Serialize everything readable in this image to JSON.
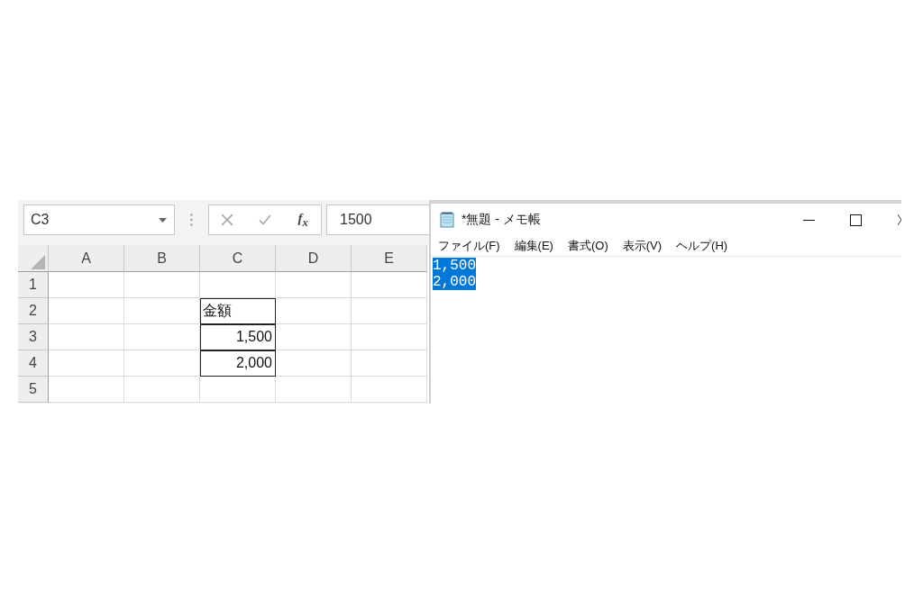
{
  "excel": {
    "name_box": {
      "value": "C3"
    },
    "formula_buttons": [
      {
        "kind": "cancel",
        "disabled": true
      },
      {
        "kind": "enter",
        "disabled": true
      },
      {
        "kind": "function",
        "label": "f$_{x}$"
      }
    ],
    "formula_bar": {
      "value": "1500"
    },
    "sheet": {
      "columns": [
        "A",
        "B",
        "C",
        "D",
        "E"
      ],
      "rows": [
        {
          "label": "1",
          "cells": [
            {
              "kind": "empty",
              "bordered": false
            },
            {
              "kind": "empty",
              "bordered": false
            },
            {
              "kind": "empty",
              "bordered": false
            },
            {
              "kind": "empty",
              "bordered": false
            },
            {
              "kind": "empty",
              "bordered": false
            }
          ]
        },
        {
          "label": "2",
          "cells": [
            {
              "kind": "empty",
              "bordered": false
            },
            {
              "kind": "empty",
              "bordered": false
            },
            {
              "kind": "text",
              "text": "金額",
              "bordered": true
            },
            {
              "kind": "empty",
              "bordered": false
            },
            {
              "kind": "empty",
              "bordered": false
            }
          ]
        },
        {
          "label": "3",
          "cells": [
            {
              "kind": "empty",
              "bordered": false
            },
            {
              "kind": "empty",
              "bordered": false
            },
            {
              "kind": "number",
              "text": "1,500",
              "bordered": true
            },
            {
              "kind": "empty",
              "bordered": false
            },
            {
              "kind": "empty",
              "bordered": false
            }
          ]
        },
        {
          "label": "4",
          "cells": [
            {
              "kind": "empty",
              "bordered": false
            },
            {
              "kind": "empty",
              "bordered": false
            },
            {
              "kind": "number",
              "text": "2,000",
              "bordered": true
            },
            {
              "kind": "empty",
              "bordered": false
            },
            {
              "kind": "empty",
              "bordered": false
            }
          ]
        },
        {
          "label": "5",
          "cells": [
            {
              "kind": "empty",
              "bordered": false
            },
            {
              "kind": "empty",
              "bordered": false
            },
            {
              "kind": "empty",
              "bordered": false
            },
            {
              "kind": "empty",
              "bordered": false
            },
            {
              "kind": "empty",
              "bordered": false
            }
          ]
        }
      ]
    }
  },
  "notepad": {
    "title": "*無題 - メモ帳",
    "menu": [
      "ファイル(F)",
      "編集(E)",
      "書式(O)",
      "表示(V)",
      "ヘルプ(H)"
    ],
    "lines": [
      {
        "text": "1,500",
        "selected": true
      },
      {
        "text": "2,000",
        "selected": true
      }
    ]
  }
}
